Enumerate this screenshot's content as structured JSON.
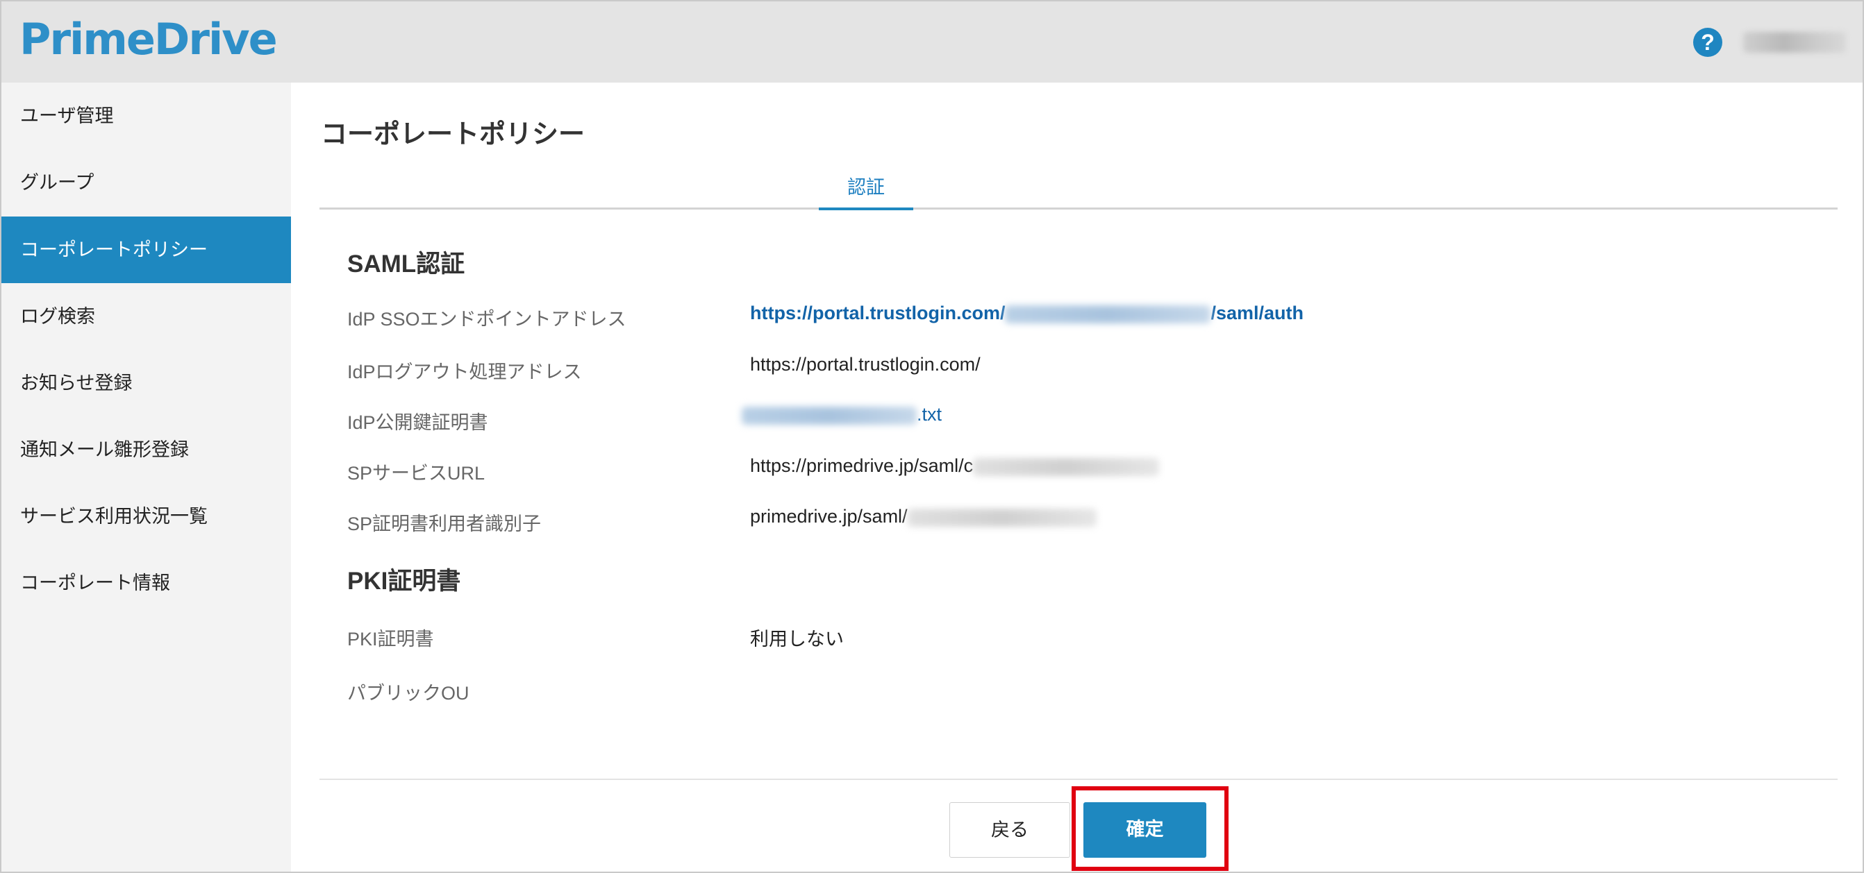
{
  "header": {
    "logo": "PrimeDrive",
    "help_icon": "?"
  },
  "sidebar": {
    "items": [
      {
        "label": "ユーザ管理",
        "active": false
      },
      {
        "label": "グループ",
        "active": false
      },
      {
        "label": "コーポレートポリシー",
        "active": true
      },
      {
        "label": "ログ検索",
        "active": false
      },
      {
        "label": "お知らせ登録",
        "active": false
      },
      {
        "label": "通知メール雛形登録",
        "active": false
      },
      {
        "label": "サービス利用状況一覧",
        "active": false
      },
      {
        "label": "コーポレート情報",
        "active": false
      }
    ]
  },
  "main": {
    "title": "コーポレートポリシー",
    "tab": "認証",
    "saml": {
      "heading": "SAML認証",
      "rows": [
        {
          "label": "IdP SSOエンドポイントアドレス",
          "value_prefix": "https://portal.trustlogin.com/",
          "value_suffix": "/saml/auth"
        },
        {
          "label": "IdPログアウト処理アドレス",
          "value": "https://portal.trustlogin.com/"
        },
        {
          "label": "IdP公開鍵証明書",
          "value_suffix": ".txt"
        },
        {
          "label": "SPサービスURL",
          "value_prefix": "https://primedrive.jp/saml/c"
        },
        {
          "label": "SP証明書利用者識別子",
          "value_prefix": "primedrive.jp/saml/"
        }
      ]
    },
    "pki": {
      "heading": "PKI証明書",
      "rows": [
        {
          "label": "PKI証明書",
          "value": "利用しない"
        },
        {
          "label": "パブリックOU",
          "value": ""
        }
      ]
    }
  },
  "footer": {
    "back_label": "戻る",
    "confirm_label": "確定"
  },
  "colors": {
    "accent": "#1e88c0",
    "logo": "#2e8fc8",
    "link": "#1263a8",
    "highlight": "#e00010"
  }
}
